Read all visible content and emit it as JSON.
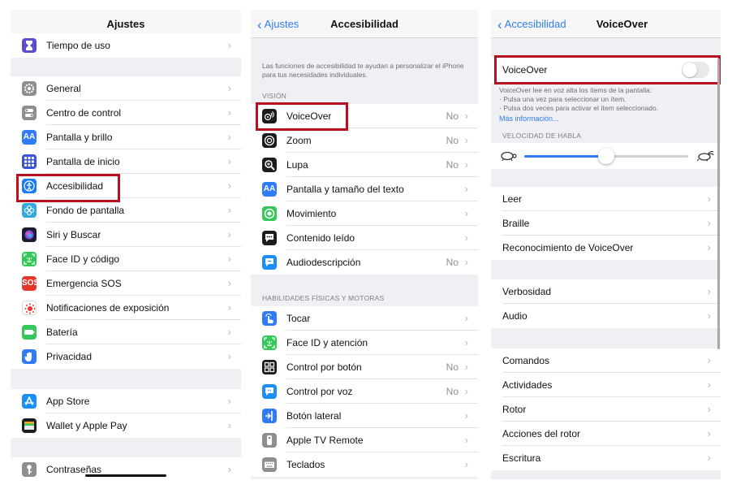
{
  "colors": {
    "accent": "#2f7cf6",
    "highlight": "#b8101f"
  },
  "panel1": {
    "title": "Ajustes",
    "rows": [
      {
        "label": "Tiempo de uso",
        "icon": "hourglass-icon",
        "color": "#5b4fd1"
      },
      {
        "label": "General",
        "icon": "gear-icon",
        "color": "#8e8e93"
      },
      {
        "label": "Centro de control",
        "icon": "toggles-icon",
        "color": "#8e8e93"
      },
      {
        "label": "Pantalla y brillo",
        "icon": "text-size-icon",
        "color": "#2f7cf6",
        "glyph": "AA"
      },
      {
        "label": "Pantalla de inicio",
        "icon": "app-grid-icon",
        "color": "#3a52d6"
      },
      {
        "label": "Accesibilidad",
        "icon": "accessibility-icon",
        "color": "#1a7cf5"
      },
      {
        "label": "Fondo de pantalla",
        "icon": "flower-icon",
        "color": "#34aadc"
      },
      {
        "label": "Siri y Buscar",
        "icon": "siri-icon",
        "color": "#1c1c2e"
      },
      {
        "label": "Face ID y código",
        "icon": "face-id-icon",
        "color": "#34c759"
      },
      {
        "label": "Emergencia SOS",
        "icon": "sos-icon",
        "color": "#e5372e",
        "glyph": "SOS"
      },
      {
        "label": "Notificaciones de exposición",
        "icon": "exposure-icon",
        "color": "#ffffff"
      },
      {
        "label": "Batería",
        "icon": "battery-icon",
        "color": "#34c759"
      },
      {
        "label": "Privacidad",
        "icon": "hand-icon",
        "color": "#2f7cf6"
      },
      {
        "label": "App Store",
        "icon": "app-store-icon",
        "color": "#1c8ef9"
      },
      {
        "label": "Wallet y Apple Pay",
        "icon": "wallet-icon",
        "color": "#1c1c1e"
      },
      {
        "label": "Contraseñas",
        "icon": "key-icon",
        "color": "#8e8e93"
      }
    ]
  },
  "panel2": {
    "back": "Ajustes",
    "title": "Accesibilidad",
    "intro": "Las funciones de accesibilidad te ayudan a personalizar el iPhone para tus necesidades individuales.",
    "section_vision": "VISIÓN",
    "section_physical": "HABILIDADES FÍSICAS Y MOTORAS",
    "vision_rows": [
      {
        "label": "VoiceOver",
        "value": "No",
        "icon": "voiceover-icon",
        "color": "#1c1c1e"
      },
      {
        "label": "Zoom",
        "value": "No",
        "icon": "zoom-icon",
        "color": "#1c1c1e"
      },
      {
        "label": "Lupa",
        "value": "No",
        "icon": "magnifier-icon",
        "color": "#1c1c1e"
      },
      {
        "label": "Pantalla y tamaño del texto",
        "value": "",
        "icon": "text-size-icon",
        "color": "#2f7cf6",
        "glyph": "AA"
      },
      {
        "label": "Movimiento",
        "value": "",
        "icon": "motion-icon",
        "color": "#34c759"
      },
      {
        "label": "Contenido leído",
        "value": "",
        "icon": "speech-bubble-icon",
        "color": "#1c1c1e"
      },
      {
        "label": "Audiodescripción",
        "value": "No",
        "icon": "audio-description-icon",
        "color": "#1c8ef9"
      }
    ],
    "physical_rows": [
      {
        "label": "Tocar",
        "value": "",
        "icon": "touch-icon",
        "color": "#2f7cf6"
      },
      {
        "label": "Face ID y atención",
        "value": "",
        "icon": "face-id-icon",
        "color": "#34c759"
      },
      {
        "label": "Control por botón",
        "value": "No",
        "icon": "switch-control-icon",
        "color": "#1c1c1e"
      },
      {
        "label": "Control por voz",
        "value": "No",
        "icon": "voice-control-icon",
        "color": "#1c8ef9"
      },
      {
        "label": "Botón lateral",
        "value": "",
        "icon": "side-button-icon",
        "color": "#2f7cf6"
      },
      {
        "label": "Apple TV Remote",
        "value": "",
        "icon": "remote-icon",
        "color": "#8e8e93"
      },
      {
        "label": "Teclados",
        "value": "",
        "icon": "keyboard-icon",
        "color": "#8e8e93"
      }
    ]
  },
  "panel3": {
    "back": "Accesibilidad",
    "title": "VoiceOver",
    "toggle_label": "VoiceOver",
    "toggle_on": false,
    "desc_lines": [
      "VoiceOver lee en voz alta los ítems de la pantalla:",
      "· Pulsa una vez para seleccionar un ítem.",
      "· Pulsa dos veces para activar el ítem seleccionado."
    ],
    "more_info": "Más información...",
    "speed_header": "VELOCIDAD DE HABLA",
    "speed_value": 0.5,
    "group1": [
      "Leer",
      "Braille",
      "Reconocimiento de VoiceOver"
    ],
    "group2": [
      "Verbosidad",
      "Audio"
    ],
    "group3": [
      "Comandos",
      "Actividades",
      "Rotor",
      "Acciones del rotor",
      "Escritura"
    ]
  }
}
